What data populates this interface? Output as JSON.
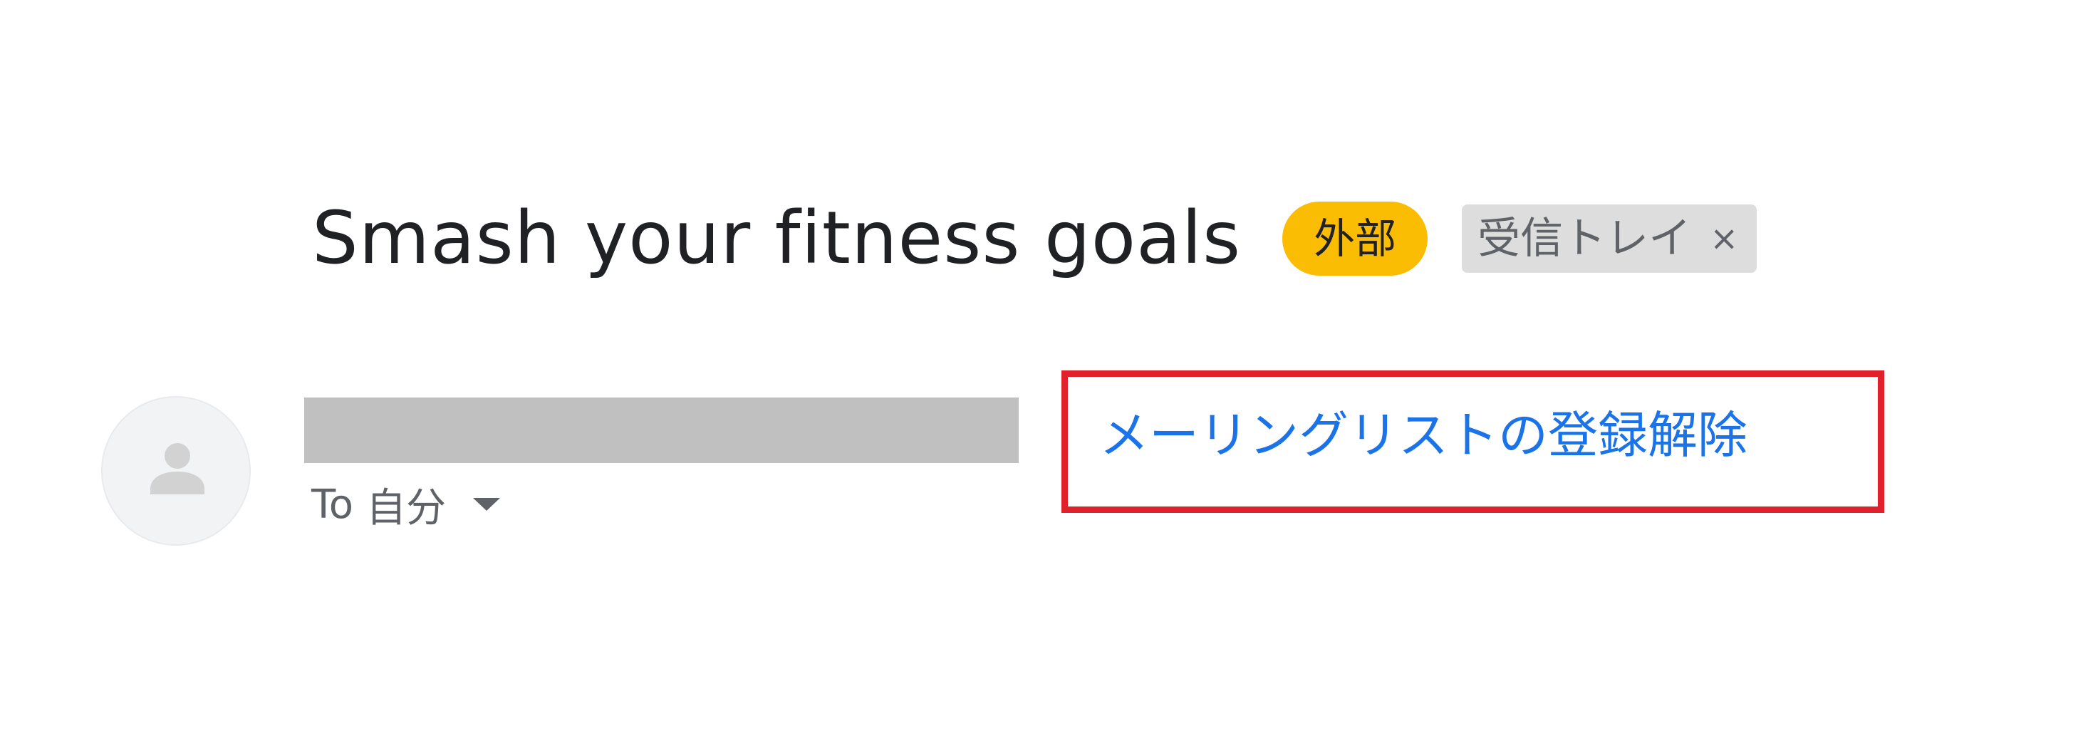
{
  "email": {
    "subject": "Smash your fitness goals",
    "labels": {
      "external": "外部",
      "inbox": "受信トレイ",
      "inbox_remove": "×"
    },
    "sender": {
      "avatar_icon": "person-icon"
    },
    "recipient": {
      "prefix": "To",
      "name": "自分"
    },
    "unsubscribe": {
      "label": "メーリングリストの登録解除"
    }
  },
  "colors": {
    "subject_text": "#202124",
    "external_label_bg": "#fbbc04",
    "inbox_label_bg": "#dddddd",
    "link": "#1a73e8",
    "highlight_box": "#e0202a",
    "redaction": "#c0c0c0"
  }
}
